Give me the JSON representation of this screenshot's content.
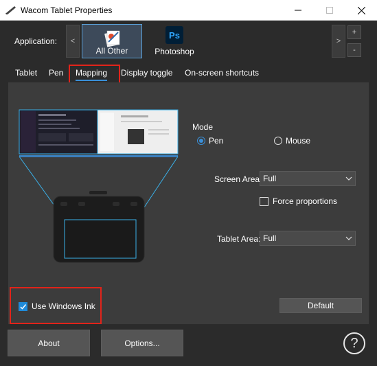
{
  "window": {
    "title": "Wacom Tablet Properties"
  },
  "application": {
    "label": "Application:",
    "tiles": [
      {
        "label": "All Other",
        "icon": "all-other-app-icon",
        "selected": true
      },
      {
        "label": "Photoshop",
        "icon": "photoshop-app-icon",
        "badge": "Ps",
        "selected": false
      }
    ],
    "scroll_left": "<",
    "scroll_right": ">",
    "add": "+",
    "remove": "-"
  },
  "tabs": [
    {
      "label": "Tablet"
    },
    {
      "label": "Pen"
    },
    {
      "label": "Mapping",
      "active": true
    },
    {
      "label": "Display toggle"
    },
    {
      "label": "On-screen shortcuts"
    }
  ],
  "mapping": {
    "mode_label": "Mode",
    "mode_options": [
      {
        "label": "Pen",
        "selected": true
      },
      {
        "label": "Mouse",
        "selected": false
      }
    ],
    "screen_area_label": "Screen Area:",
    "screen_area_value": "Full",
    "force_proportions_label": "Force proportions",
    "force_proportions_checked": false,
    "tablet_area_label": "Tablet Area:",
    "tablet_area_value": "Full",
    "use_windows_ink_label": "Use Windows Ink",
    "use_windows_ink_checked": true,
    "default_label": "Default"
  },
  "footer": {
    "about_label": "About",
    "options_label": "Options...",
    "help_label": "?"
  },
  "colors": {
    "accent": "#3a8fd8",
    "highlight": "#e2231a",
    "background": "#2b2b2b",
    "panel": "#3c3c3c"
  }
}
